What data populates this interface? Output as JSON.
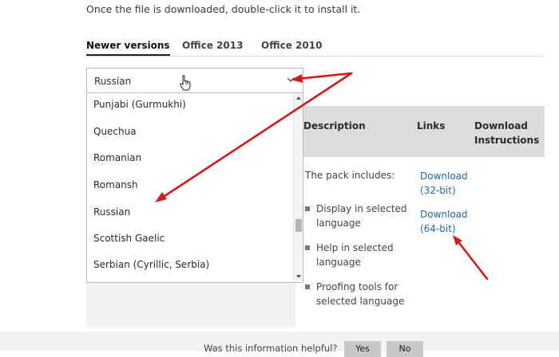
{
  "intro_text": "Once the file is downloaded, double-click it to install it.",
  "tabs": [
    {
      "label": "Newer versions",
      "active": true
    },
    {
      "label": "Office 2013",
      "active": false
    },
    {
      "label": "Office 2010",
      "active": false
    }
  ],
  "language_select": {
    "value": "Russian",
    "options": [
      "Punjabi (Gurmukhi)",
      "Quechua",
      "Romanian",
      "Romansh",
      "Russian",
      "Scottish Gaelic",
      "Serbian (Cyrillic, Serbia)"
    ]
  },
  "table": {
    "headers": {
      "description": "Description",
      "links": "Links",
      "instructions": "Download Instructions"
    },
    "pack_includes": "The pack includes:",
    "bullets": [
      "Display in selected language",
      "Help in selected language",
      "Proofing tools for selected language"
    ],
    "links": [
      "Download (32-bit)",
      "Download (64-bit)"
    ]
  },
  "feedback": {
    "question": "Was this information helpful?",
    "yes": "Yes",
    "no": "No"
  },
  "colors": {
    "link": "#1f6aa5",
    "annotation_arrow": "#d11a1a",
    "header_bg": "#dcdcdc"
  },
  "icons": [
    "chevron-down-icon",
    "hand-cursor-icon",
    "scroll-up-icon",
    "scroll-down-icon"
  ]
}
